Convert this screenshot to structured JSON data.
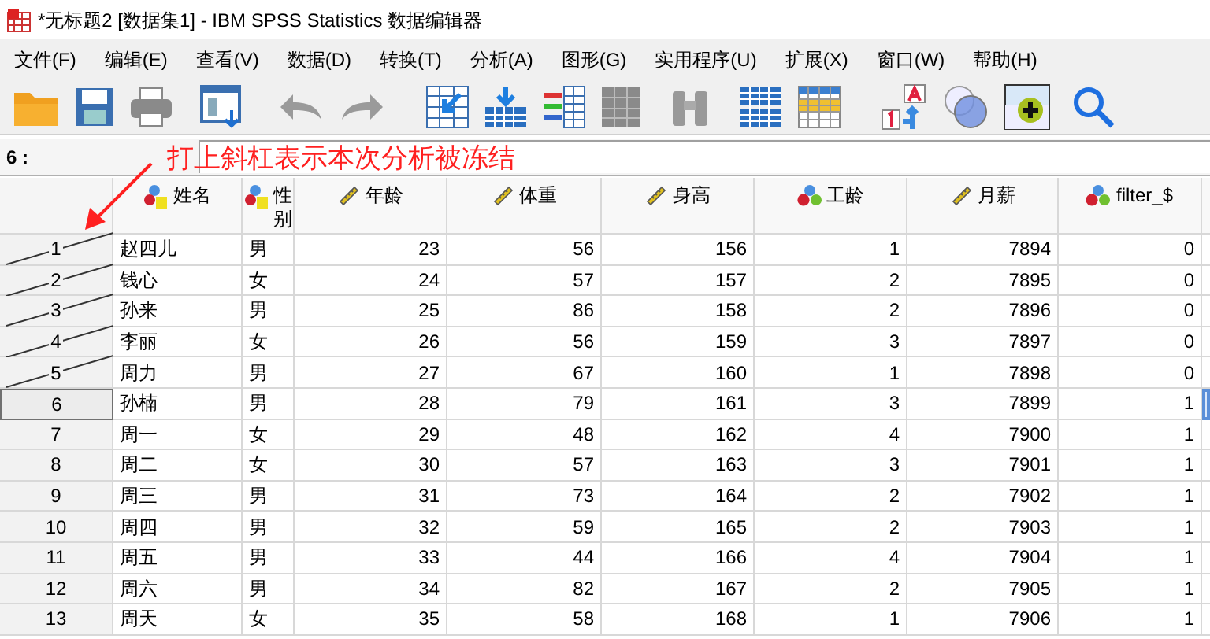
{
  "window": {
    "title": "*无标题2 [数据集1] - IBM SPSS Statistics 数据编辑器"
  },
  "menu": [
    "文件(F)",
    "编辑(E)",
    "查看(V)",
    "数据(D)",
    "转换(T)",
    "分析(A)",
    "图形(G)",
    "实用程序(U)",
    "扩展(X)",
    "窗口(W)",
    "帮助(H)"
  ],
  "cell_ref": {
    "label": "6 :"
  },
  "annotation": {
    "text": "打上斜杠表示本次分析被冻结"
  },
  "columns": [
    {
      "name": "姓名",
      "kind": "string"
    },
    {
      "name": "性别",
      "kind": "string"
    },
    {
      "name": "年龄",
      "kind": "scale"
    },
    {
      "name": "体重",
      "kind": "scale"
    },
    {
      "name": "身高",
      "kind": "scale"
    },
    {
      "name": "工龄",
      "kind": "nominal"
    },
    {
      "name": "月薪",
      "kind": "scale"
    },
    {
      "name": "filter_$",
      "kind": "nominal"
    }
  ],
  "rows": [
    {
      "number": "1",
      "struck": true,
      "selected": false,
      "cells": [
        "赵四儿",
        "男",
        "23",
        "56",
        "156",
        "1",
        "7894",
        "0"
      ]
    },
    {
      "number": "2",
      "struck": true,
      "selected": false,
      "cells": [
        "钱心",
        "女",
        "24",
        "57",
        "157",
        "2",
        "7895",
        "0"
      ]
    },
    {
      "number": "3",
      "struck": true,
      "selected": false,
      "cells": [
        "孙来",
        "男",
        "25",
        "86",
        "158",
        "2",
        "7896",
        "0"
      ]
    },
    {
      "number": "4",
      "struck": true,
      "selected": false,
      "cells": [
        "李丽",
        "女",
        "26",
        "56",
        "159",
        "3",
        "7897",
        "0"
      ]
    },
    {
      "number": "5",
      "struck": true,
      "selected": false,
      "cells": [
        "周力",
        "男",
        "27",
        "67",
        "160",
        "1",
        "7898",
        "0"
      ]
    },
    {
      "number": "6",
      "struck": false,
      "selected": true,
      "cells": [
        "孙楠",
        "男",
        "28",
        "79",
        "161",
        "3",
        "7899",
        "1"
      ]
    },
    {
      "number": "7",
      "struck": false,
      "selected": false,
      "cells": [
        "周一",
        "女",
        "29",
        "48",
        "162",
        "4",
        "7900",
        "1"
      ]
    },
    {
      "number": "8",
      "struck": false,
      "selected": false,
      "cells": [
        "周二",
        "女",
        "30",
        "57",
        "163",
        "3",
        "7901",
        "1"
      ]
    },
    {
      "number": "9",
      "struck": false,
      "selected": false,
      "cells": [
        "周三",
        "男",
        "31",
        "73",
        "164",
        "2",
        "7902",
        "1"
      ]
    },
    {
      "number": "10",
      "struck": false,
      "selected": false,
      "cells": [
        "周四",
        "男",
        "32",
        "59",
        "165",
        "2",
        "7903",
        "1"
      ]
    },
    {
      "number": "11",
      "struck": false,
      "selected": false,
      "cells": [
        "周五",
        "男",
        "33",
        "44",
        "166",
        "4",
        "7904",
        "1"
      ]
    },
    {
      "number": "12",
      "struck": false,
      "selected": false,
      "cells": [
        "周六",
        "男",
        "34",
        "82",
        "167",
        "2",
        "7905",
        "1"
      ]
    },
    {
      "number": "13",
      "struck": false,
      "selected": false,
      "cells": [
        "周天",
        "女",
        "35",
        "58",
        "168",
        "1",
        "7906",
        "1"
      ]
    }
  ]
}
